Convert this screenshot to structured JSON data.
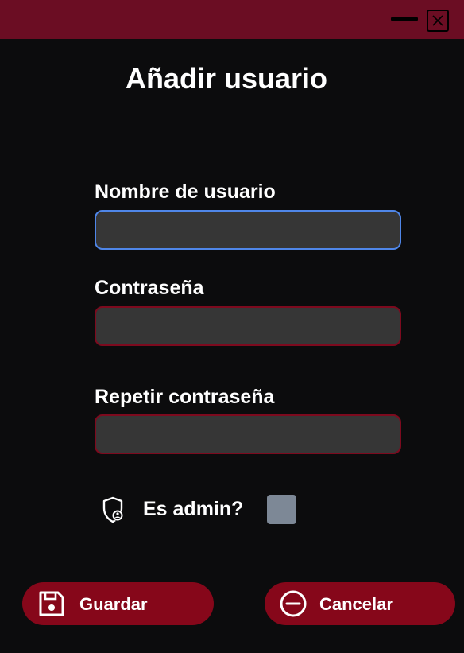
{
  "window": {
    "title": "Añadir usuario",
    "minimize_icon": "minimize-icon",
    "close_icon": "close-icon"
  },
  "form": {
    "username": {
      "label": "Nombre de usuario",
      "value": "",
      "placeholder": ""
    },
    "password": {
      "label": "Contraseña",
      "value": "",
      "placeholder": ""
    },
    "repeat_password": {
      "label": "Repetir contraseña",
      "value": "",
      "placeholder": ""
    },
    "admin": {
      "label": "Es admin?",
      "checked": false,
      "icon": "admin-shield-icon"
    }
  },
  "actions": {
    "save": {
      "label": "Guardar",
      "icon": "save-icon"
    },
    "cancel": {
      "label": "Cancelar",
      "icon": "minus-circle-icon"
    }
  },
  "colors": {
    "titlebar": "#6b0d23",
    "background": "#0c0c0d",
    "button": "#86071a",
    "input_border": "#7d0a1e",
    "focus_border": "#4f86e8",
    "input_fill": "#363636",
    "checkbox": "#7d8896"
  }
}
